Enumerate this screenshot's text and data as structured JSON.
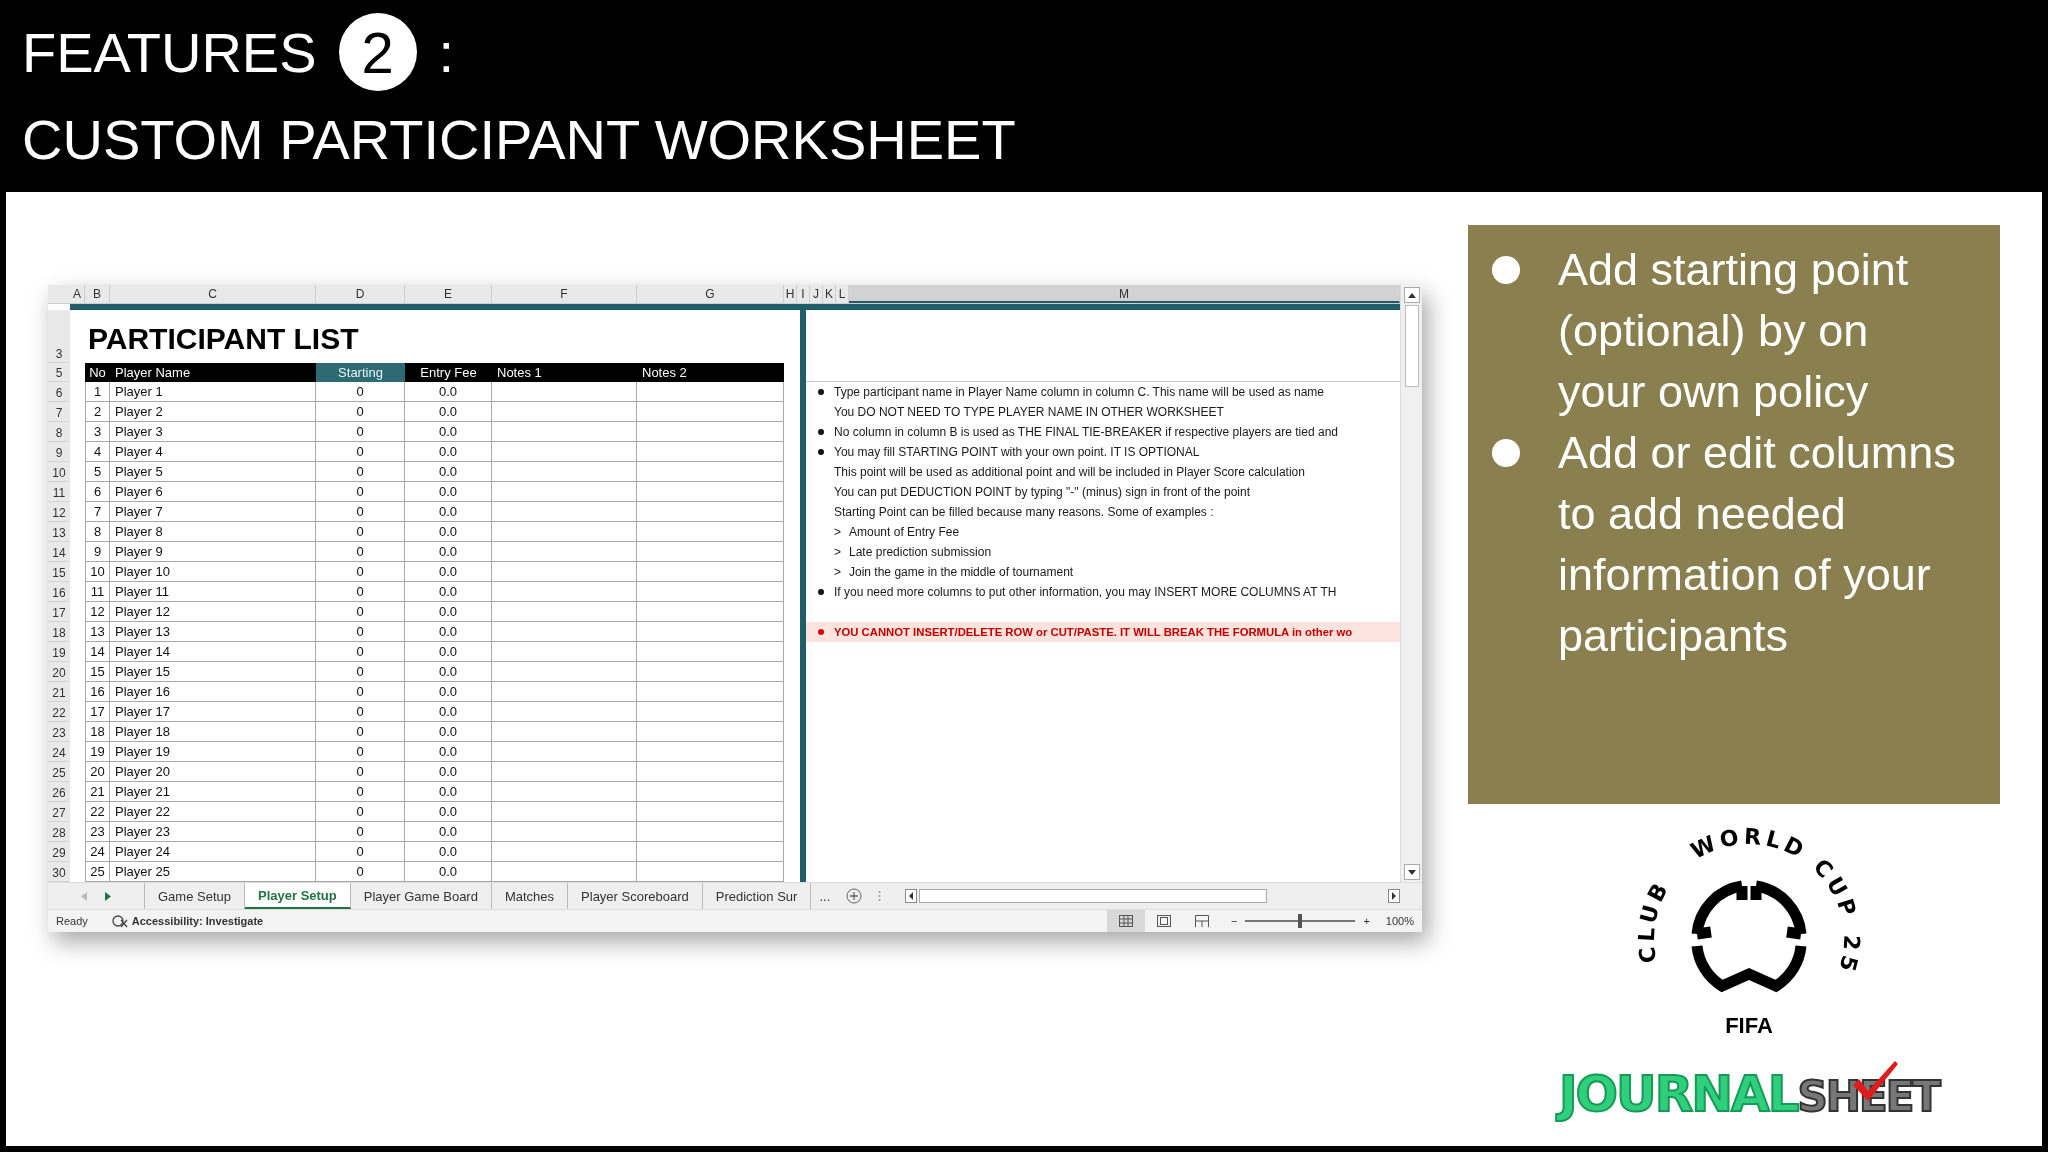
{
  "slide": {
    "title": "FEATURES",
    "badge": "2",
    "title_suffix": ":",
    "subtitle": "CUSTOM PARTICIPANT WORKSHEET"
  },
  "spreadsheet": {
    "column_headers": [
      {
        "label": "A",
        "selected": false
      },
      {
        "label": "B",
        "selected": false
      },
      {
        "label": "C",
        "selected": false
      },
      {
        "label": "D",
        "selected": false
      },
      {
        "label": "E",
        "selected": false
      },
      {
        "label": "F",
        "selected": false
      },
      {
        "label": "G",
        "selected": false
      },
      {
        "label": "H",
        "selected": false
      },
      {
        "label": "I",
        "selected": false
      },
      {
        "label": "J",
        "selected": false
      },
      {
        "label": "K",
        "selected": false
      },
      {
        "label": "L",
        "selected": false
      },
      {
        "label": "M",
        "selected": true
      }
    ],
    "title_row_number": "3",
    "header_row_number": "5",
    "sheet_title": "PARTICIPANT LIST",
    "table_columns": [
      {
        "label": "No",
        "selected": false
      },
      {
        "label": "Player Name",
        "selected": false
      },
      {
        "label": "Starting",
        "selected": true
      },
      {
        "label": "Entry Fee",
        "selected": false
      },
      {
        "label": "Notes 1",
        "selected": false
      },
      {
        "label": "Notes 2",
        "selected": false
      }
    ],
    "rows": [
      {
        "row_number": "6",
        "no": "1",
        "player_name": "Player 1",
        "starting": "0",
        "entry_fee": "0.0"
      },
      {
        "row_number": "7",
        "no": "2",
        "player_name": "Player 2",
        "starting": "0",
        "entry_fee": "0.0"
      },
      {
        "row_number": "8",
        "no": "3",
        "player_name": "Player 3",
        "starting": "0",
        "entry_fee": "0.0"
      },
      {
        "row_number": "9",
        "no": "4",
        "player_name": "Player 4",
        "starting": "0",
        "entry_fee": "0.0"
      },
      {
        "row_number": "10",
        "no": "5",
        "player_name": "Player 5",
        "starting": "0",
        "entry_fee": "0.0"
      },
      {
        "row_number": "11",
        "no": "6",
        "player_name": "Player 6",
        "starting": "0",
        "entry_fee": "0.0"
      },
      {
        "row_number": "12",
        "no": "7",
        "player_name": "Player 7",
        "starting": "0",
        "entry_fee": "0.0"
      },
      {
        "row_number": "13",
        "no": "8",
        "player_name": "Player 8",
        "starting": "0",
        "entry_fee": "0.0"
      },
      {
        "row_number": "14",
        "no": "9",
        "player_name": "Player 9",
        "starting": "0",
        "entry_fee": "0.0"
      },
      {
        "row_number": "15",
        "no": "10",
        "player_name": "Player 10",
        "starting": "0",
        "entry_fee": "0.0"
      },
      {
        "row_number": "16",
        "no": "11",
        "player_name": "Player 11",
        "starting": "0",
        "entry_fee": "0.0"
      },
      {
        "row_number": "17",
        "no": "12",
        "player_name": "Player 12",
        "starting": "0",
        "entry_fee": "0.0"
      },
      {
        "row_number": "18",
        "no": "13",
        "player_name": "Player 13",
        "starting": "0",
        "entry_fee": "0.0"
      },
      {
        "row_number": "19",
        "no": "14",
        "player_name": "Player 14",
        "starting": "0",
        "entry_fee": "0.0"
      },
      {
        "row_number": "20",
        "no": "15",
        "player_name": "Player 15",
        "starting": "0",
        "entry_fee": "0.0"
      },
      {
        "row_number": "21",
        "no": "16",
        "player_name": "Player 16",
        "starting": "0",
        "entry_fee": "0.0"
      },
      {
        "row_number": "22",
        "no": "17",
        "player_name": "Player 17",
        "starting": "0",
        "entry_fee": "0.0"
      },
      {
        "row_number": "23",
        "no": "18",
        "player_name": "Player 18",
        "starting": "0",
        "entry_fee": "0.0"
      },
      {
        "row_number": "24",
        "no": "19",
        "player_name": "Player 19",
        "starting": "0",
        "entry_fee": "0.0"
      },
      {
        "row_number": "25",
        "no": "20",
        "player_name": "Player 20",
        "starting": "0",
        "entry_fee": "0.0"
      },
      {
        "row_number": "26",
        "no": "21",
        "player_name": "Player 21",
        "starting": "0",
        "entry_fee": "0.0"
      },
      {
        "row_number": "27",
        "no": "22",
        "player_name": "Player 22",
        "starting": "0",
        "entry_fee": "0.0"
      },
      {
        "row_number": "28",
        "no": "23",
        "player_name": "Player 23",
        "starting": "0",
        "entry_fee": "0.0"
      },
      {
        "row_number": "29",
        "no": "24",
        "player_name": "Player 24",
        "starting": "0",
        "entry_fee": "0.0"
      },
      {
        "row_number": "30",
        "no": "25",
        "player_name": "Player 25",
        "starting": "0",
        "entry_fee": "0.0"
      }
    ],
    "notes": [
      {
        "kind": "bullet",
        "text": "Type participant name in Player Name column in column C. This name will be used as name"
      },
      {
        "kind": "plain",
        "text": "You DO NOT NEED TO TYPE PLAYER NAME IN OTHER WORKSHEET"
      },
      {
        "kind": "bullet",
        "text": "No column in column B is used as THE FINAL TIE-BREAKER if respective players are tied and"
      },
      {
        "kind": "bullet",
        "text": "You may fill STARTING POINT with your own point. IT IS OPTIONAL"
      },
      {
        "kind": "plain",
        "text": "This point will be used as additional point and will be included in Player Score calculation"
      },
      {
        "kind": "plain",
        "text": "You can put DEDUCTION POINT by typing \"-\" (minus) sign in front of the point"
      },
      {
        "kind": "plain",
        "text": "Starting Point can be filled because many reasons. Some of examples :"
      },
      {
        "kind": "sub",
        "marker": ">",
        "text": "Amount of Entry Fee"
      },
      {
        "kind": "sub",
        "marker": ">",
        "text": "Late prediction submission"
      },
      {
        "kind": "sub",
        "marker": ">",
        "text": "Join the game in the middle of tournament"
      },
      {
        "kind": "bullet",
        "text": "If you need more columns to put other information, you may INSERT MORE COLUMNS AT TH"
      },
      {
        "kind": "warning",
        "text": "YOU CANNOT INSERT/DELETE ROW or CUT/PASTE. IT WILL BREAK THE FORMULA in other wo"
      }
    ],
    "sheet_tabs": [
      {
        "label": "Game Setup",
        "selected": false
      },
      {
        "label": "Player Setup",
        "selected": true
      },
      {
        "label": "Player Game Board",
        "selected": false
      },
      {
        "label": "Matches",
        "selected": false
      },
      {
        "label": "Player Scoreboard",
        "selected": false
      },
      {
        "label": "Prediction Sur",
        "selected": false
      }
    ],
    "more_tabs": "...",
    "status_bar": {
      "status": "Ready",
      "accessibility": "Accessibility: Investigate",
      "views": [
        {
          "kind": "normal",
          "selected": true
        },
        {
          "kind": "page_layout",
          "selected": false
        },
        {
          "kind": "page_break",
          "selected": false
        }
      ],
      "zoom": {
        "minus": "−",
        "plus": "+",
        "level": 0.5,
        "reading": "100%"
      }
    }
  },
  "panel": {
    "bullets": [
      "Add starting point (optional) by on your own policy",
      "Add or edit columns to add needed information of your participants"
    ]
  },
  "emblem": {
    "arc_words": [
      "CLUB",
      "WORLD",
      "CUP",
      "25"
    ],
    "wordmark": "FIFA"
  },
  "brand": {
    "part_1": "JOURNAL",
    "part_2": "SHEET"
  }
}
